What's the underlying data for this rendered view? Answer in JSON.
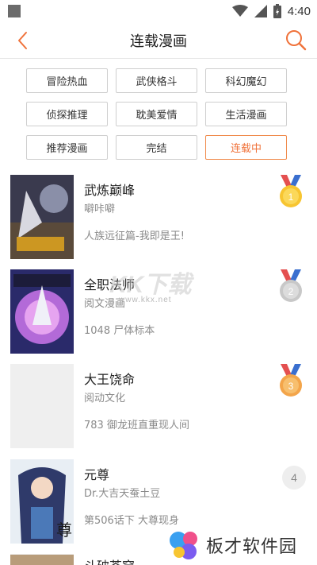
{
  "status_bar": {
    "time": "4:40",
    "icons": [
      "notification-square-icon",
      "wifi-icon",
      "signal-icon",
      "battery-charging-icon"
    ]
  },
  "header": {
    "title": "连载漫画",
    "back_icon": "chevron-left-icon",
    "search_icon": "search-icon",
    "accent": "#f0723a"
  },
  "tags": [
    {
      "label": "冒险热血",
      "active": false
    },
    {
      "label": "武侠格斗",
      "active": false
    },
    {
      "label": "科幻魔幻",
      "active": false
    },
    {
      "label": "侦探推理",
      "active": false
    },
    {
      "label": "耽美爱情",
      "active": false
    },
    {
      "label": "生活漫画",
      "active": false
    },
    {
      "label": "推荐漫画",
      "active": false
    },
    {
      "label": "完结",
      "active": false
    },
    {
      "label": "连载中",
      "active": true
    }
  ],
  "comics": [
    {
      "title": "武炼巅峰",
      "author": "噼咔噼",
      "desc": "人族远征篇-我即是王!",
      "rank": "1",
      "rank_style": "gold-medal"
    },
    {
      "title": "全职法师",
      "author": "阅文漫画",
      "desc": "1048 尸体标本",
      "rank": "2",
      "rank_style": "silver-medal"
    },
    {
      "title": "大王饶命",
      "author": "阅动文化",
      "desc": "783 御龙班直重现人间",
      "rank": "3",
      "rank_style": "bronze-medal"
    },
    {
      "title": "元尊",
      "author": "Dr.大吉天蚕土豆",
      "desc": "第506话下 大尊现身",
      "rank": "4",
      "rank_style": "plain"
    },
    {
      "title": "斗破苍穹",
      "author": "",
      "desc": "",
      "rank": "",
      "rank_style": "plain"
    }
  ],
  "watermarks": {
    "kkx_url": "www.kkx.net",
    "kkx_logo_text": "KK下载",
    "bancai": "板才软件园"
  }
}
